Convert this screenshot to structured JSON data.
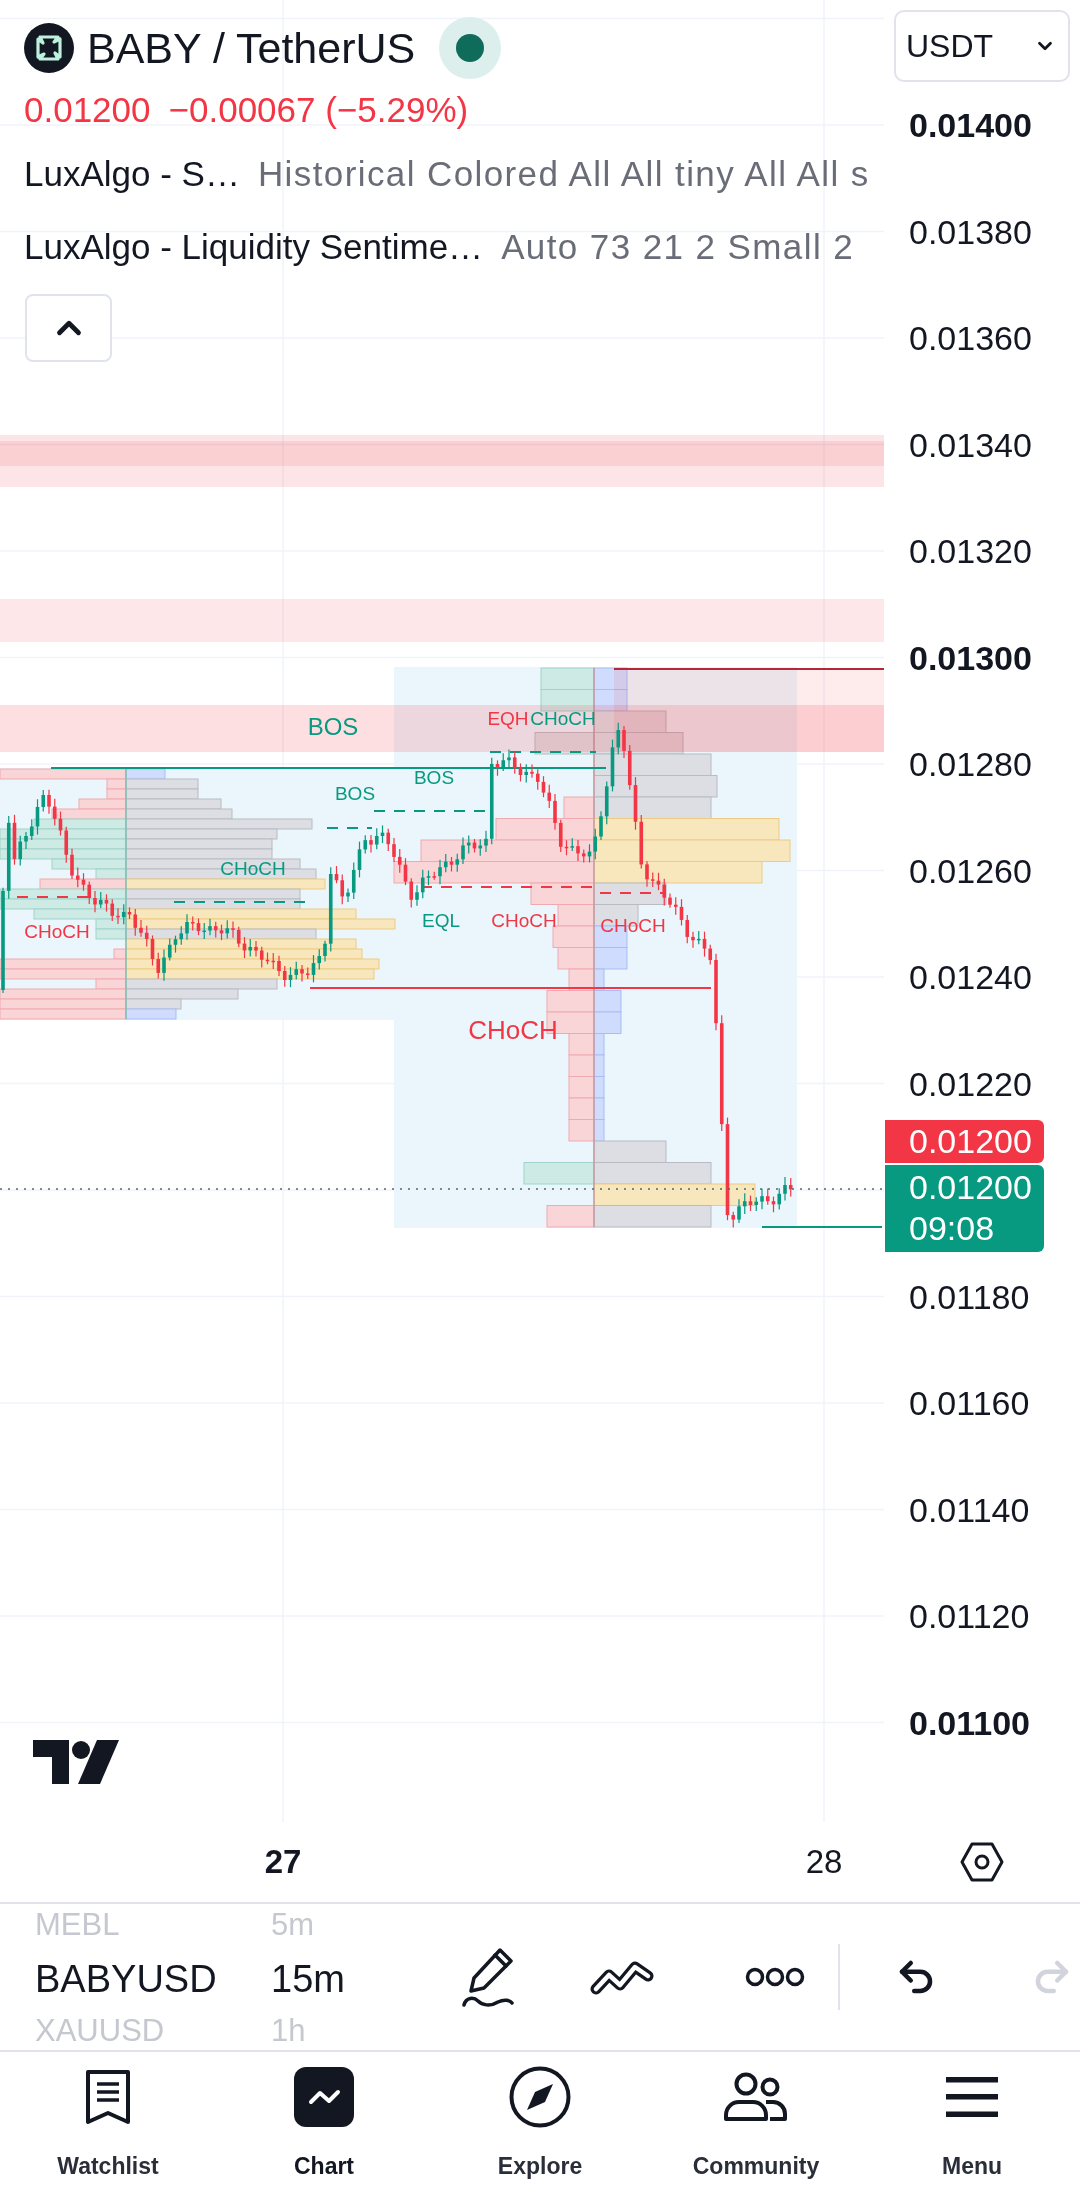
{
  "header": {
    "symbol": "BABY / TetherUS",
    "currency": "USDT",
    "price": "0.01200",
    "change": "−0.00067 (−5.29%)"
  },
  "indicators": [
    {
      "name": "LuxAlgo - S…",
      "params": "Historical Colored All All tiny All All s"
    },
    {
      "name": "LuxAlgo - Liquidity Sentime…",
      "params": "Auto 73 21 2 Small 2"
    }
  ],
  "price_axis": {
    "ticks": [
      {
        "label": "0.01400",
        "major": true
      },
      {
        "label": "0.01380",
        "major": false
      },
      {
        "label": "0.01360",
        "major": false
      },
      {
        "label": "0.01340",
        "major": false
      },
      {
        "label": "0.01320",
        "major": false
      },
      {
        "label": "0.01300",
        "major": true
      },
      {
        "label": "0.01280",
        "major": false
      },
      {
        "label": "0.01260",
        "major": false
      },
      {
        "label": "0.01240",
        "major": false
      },
      {
        "label": "0.01220",
        "major": false
      },
      {
        "label": "0.01180",
        "major": false
      },
      {
        "label": "0.01160",
        "major": false
      },
      {
        "label": "0.01140",
        "major": false
      },
      {
        "label": "0.01120",
        "major": false
      },
      {
        "label": "0.01100",
        "major": true
      }
    ],
    "last_price": "0.01200",
    "current_price": "0.01200",
    "countdown": "09:08"
  },
  "chart": {
    "labels": [
      {
        "text": "EQH",
        "color": "#f23645"
      },
      {
        "text": "CHoCH",
        "color": "#089981"
      },
      {
        "text": "BOS",
        "color": "#089981"
      },
      {
        "text": "BOS",
        "color": "#089981"
      },
      {
        "text": "BOS",
        "color": "#089981"
      },
      {
        "text": "CHoCH",
        "color": "#089981"
      },
      {
        "text": "EQL",
        "color": "#089981"
      },
      {
        "text": "CHoCH",
        "color": "#f23645"
      },
      {
        "text": "CHoCH",
        "color": "#f23645"
      },
      {
        "text": "CHoCH",
        "color": "#f23645"
      },
      {
        "text": "CHoCH",
        "color": "#f23645"
      }
    ]
  },
  "time_axis": {
    "ticks": [
      {
        "label": "27",
        "major": true
      },
      {
        "label": "28",
        "major": false
      }
    ]
  },
  "toolbar": {
    "symbols": [
      {
        "symbol": "MEBL",
        "interval": "5m",
        "selected": false
      },
      {
        "symbol": "BABYUSD",
        "interval": "15m",
        "selected": true
      },
      {
        "symbol": "XAUUSD",
        "interval": "1h",
        "selected": false
      }
    ],
    "actions": [
      {
        "kind": "draw",
        "disabled": false
      },
      {
        "kind": "lines",
        "disabled": false
      },
      {
        "kind": "more",
        "disabled": false
      },
      {
        "kind": "undo",
        "disabled": false
      },
      {
        "kind": "redo",
        "disabled": true
      }
    ]
  },
  "nav": [
    {
      "label": "Watchlist",
      "selected": false
    },
    {
      "label": "Chart",
      "selected": true
    },
    {
      "label": "Explore",
      "selected": false
    },
    {
      "label": "Community",
      "selected": false
    },
    {
      "label": "Menu",
      "selected": false
    }
  ]
}
